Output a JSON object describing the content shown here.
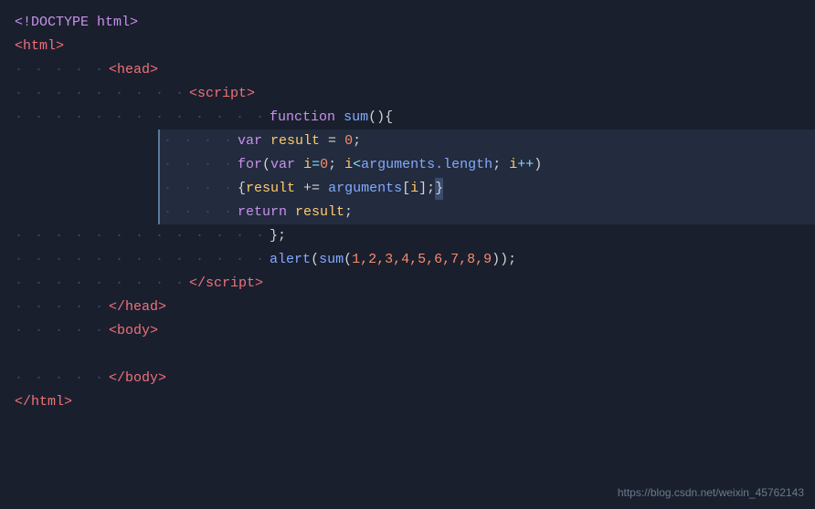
{
  "watermark": "https://blog.csdn.net/weixin_45762143",
  "lines": [
    {
      "id": "line1",
      "dots": "",
      "indent": 0,
      "content": "doctype",
      "highlighted": false
    },
    {
      "id": "line2",
      "dots": "",
      "indent": 0,
      "content": "html_open",
      "highlighted": false
    },
    {
      "id": "line3",
      "dots": "·····",
      "indent": 1,
      "content": "head_open",
      "highlighted": false
    },
    {
      "id": "line4",
      "dots": "·········",
      "indent": 2,
      "content": "script_open",
      "highlighted": false
    },
    {
      "id": "line5",
      "dots": "·············",
      "indent": 3,
      "content": "function_decl",
      "highlighted": false
    },
    {
      "id": "line6",
      "dots": "·················",
      "indent": 4,
      "content": "var_result",
      "highlighted": true
    },
    {
      "id": "line7",
      "dots": "·················",
      "indent": 4,
      "content": "for_loop",
      "highlighted": true
    },
    {
      "id": "line8",
      "dots": "·················",
      "indent": 4,
      "content": "result_assign",
      "highlighted": true
    },
    {
      "id": "line9",
      "dots": "·················",
      "indent": 4,
      "content": "return_stmt",
      "highlighted": true
    },
    {
      "id": "line10",
      "dots": "·············",
      "indent": 3,
      "content": "close_brace",
      "highlighted": false
    },
    {
      "id": "line11",
      "dots": "·············",
      "indent": 3,
      "content": "alert_call",
      "highlighted": false
    },
    {
      "id": "line12",
      "dots": "·········",
      "indent": 2,
      "content": "script_close",
      "highlighted": false
    },
    {
      "id": "line13",
      "dots": "·····",
      "indent": 1,
      "content": "head_close",
      "highlighted": false
    },
    {
      "id": "line14",
      "dots": "·····",
      "indent": 1,
      "content": "body_open",
      "highlighted": false
    },
    {
      "id": "line15",
      "dots": "",
      "indent": 0,
      "content": "empty",
      "highlighted": false
    },
    {
      "id": "line16",
      "dots": "·····",
      "indent": 1,
      "content": "body_close",
      "highlighted": false
    },
    {
      "id": "line17",
      "dots": "",
      "indent": 0,
      "content": "html_close",
      "highlighted": false
    }
  ]
}
